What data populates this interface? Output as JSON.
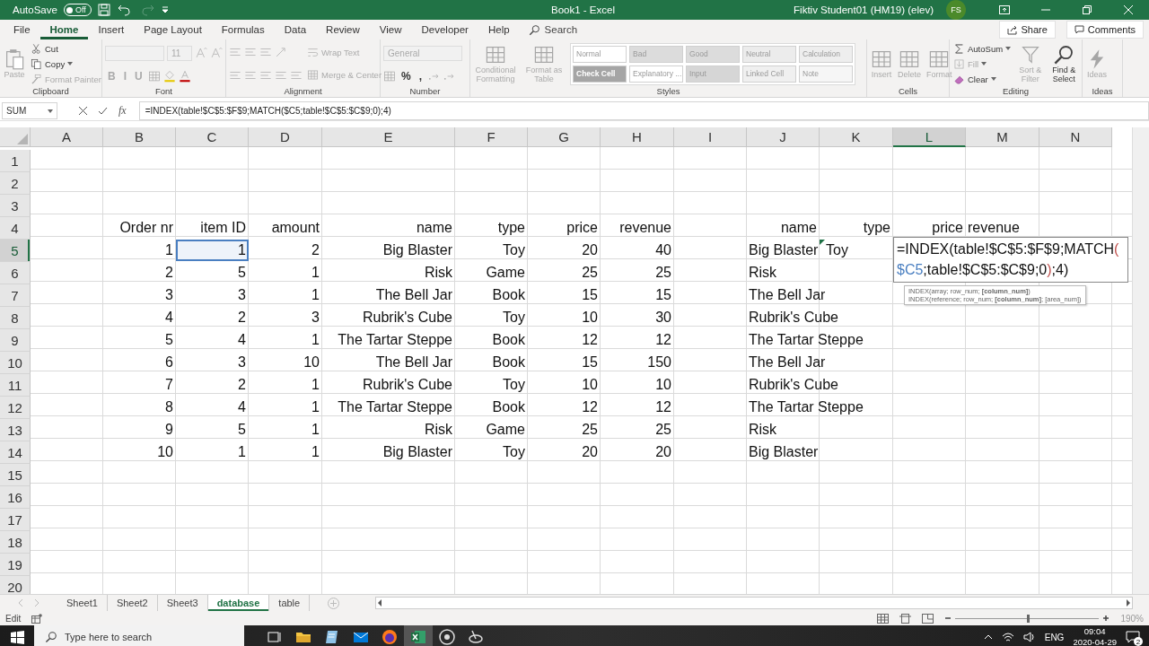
{
  "title_bar": {
    "autosave_label": "AutoSave",
    "autosave_state": "Off",
    "autosave_on": false,
    "title": "Book1  -  Excel",
    "user": "Fiktiv Student01 (HM19) (elev)",
    "avatar": "FS"
  },
  "ribbon_tabs": [
    {
      "label": "File",
      "selected": false
    },
    {
      "label": "Home",
      "selected": true
    },
    {
      "label": "Insert",
      "selected": false
    },
    {
      "label": "Page Layout",
      "selected": false
    },
    {
      "label": "Formulas",
      "selected": false
    },
    {
      "label": "Data",
      "selected": false
    },
    {
      "label": "Review",
      "selected": false
    },
    {
      "label": "View",
      "selected": false
    },
    {
      "label": "Developer",
      "selected": false
    },
    {
      "label": "Help",
      "selected": false
    }
  ],
  "search": "Search",
  "share": "Share",
  "comments": "Comments",
  "ribbon_groups": [
    {
      "label": "Clipboard",
      "columns": [
        [
          [
            {
              "kind": "large",
              "label": "Paste",
              "disabled": true
            }
          ]
        ],
        [
          [
            {
              "kind": "small",
              "label": "Cut",
              "disabled": false
            }
          ],
          [
            {
              "kind": "small",
              "label": "Copy",
              "disabled": false,
              "caret": true
            }
          ],
          [
            {
              "kind": "small",
              "label": "Format Painter",
              "disabled": true
            }
          ]
        ]
      ]
    },
    {
      "label": "Font",
      "columns": [
        [
          [
            {
              "kind": "field",
              "disabled": true
            },
            {
              "kind": "field",
              "text": "11",
              "disabled": true
            },
            {
              "kind": "icon"
            },
            {
              "kind": "icon"
            }
          ],
          [
            {
              "kind": "glyph",
              "text": "B",
              "disabled": true
            },
            {
              "kind": "glyph",
              "text": "I",
              "disabled": true
            },
            {
              "kind": "glyph",
              "text": "U",
              "disabled": true
            },
            {
              "kind": "icon"
            },
            {
              "kind": "icon"
            },
            {
              "kind": "icon"
            }
          ]
        ]
      ]
    },
    {
      "label": "Alignment",
      "columns": [
        [
          [
            {
              "kind": "icon"
            },
            {
              "kind": "icon"
            },
            {
              "kind": "icon"
            },
            {
              "kind": "icon"
            }
          ],
          [
            {
              "kind": "icon"
            },
            {
              "kind": "icon"
            },
            {
              "kind": "icon"
            },
            {
              "kind": "icon"
            },
            {
              "kind": "icon"
            }
          ]
        ],
        [
          [
            {
              "kind": "small",
              "label": "Wrap Text",
              "disabled": true
            }
          ],
          [
            {
              "kind": "small",
              "label": "Merge & Center",
              "disabled": true
            }
          ]
        ]
      ]
    },
    {
      "label": "Number",
      "columns": [
        [
          [
            {
              "kind": "field",
              "text": "General",
              "disabled": true
            }
          ],
          [
            {
              "kind": "icon"
            },
            {
              "kind": "glyph",
              "text": "%",
              "disabled": false
            },
            {
              "kind": "glyph",
              "text": ",",
              "disabled": false
            },
            {
              "kind": "icon"
            },
            {
              "kind": "icon"
            }
          ]
        ]
      ]
    },
    {
      "label": "Styles",
      "columns": [
        [
          [
            {
              "kind": "large",
              "label": "Conditional Formatting",
              "disabled": true
            }
          ]
        ],
        [
          [
            {
              "kind": "large",
              "label": "Format as Table",
              "disabled": true
            }
          ]
        ],
        [
          [
            {
              "kind": "style",
              "label": "Normal",
              "color": "#ffffff"
            },
            {
              "kind": "style",
              "label": "Bad",
              "color": "#dcdcdc"
            },
            {
              "kind": "style",
              "label": "Good",
              "color": "#dcdcdc"
            },
            {
              "kind": "style",
              "label": "Neutral",
              "color": "#ececec"
            },
            {
              "kind": "style",
              "label": "Calculation",
              "color": "#eeeeee"
            }
          ],
          [
            {
              "kind": "style",
              "label": "Check Cell",
              "color": "#a5a5a5"
            },
            {
              "kind": "style",
              "label": "Explanatory ...",
              "color": "#ffffff"
            },
            {
              "kind": "style",
              "label": "Input",
              "color": "#d6d6d6"
            },
            {
              "kind": "style",
              "label": "Linked Cell",
              "color": "#f0f0f0"
            },
            {
              "kind": "style",
              "label": "Note",
              "color": "#f6f6f6"
            }
          ]
        ]
      ]
    },
    {
      "label": "Cells",
      "columns": [
        [
          [
            {
              "kind": "large",
              "label": "Insert",
              "disabled": true
            }
          ]
        ],
        [
          [
            {
              "kind": "large",
              "label": "Delete",
              "disabled": true
            }
          ]
        ],
        [
          [
            {
              "kind": "large",
              "label": "Format",
              "disabled": true
            }
          ]
        ]
      ]
    },
    {
      "label": "Editing",
      "columns": [
        [
          [
            {
              "kind": "small",
              "label": "AutoSum",
              "disabled": false,
              "caret": true
            }
          ],
          [
            {
              "kind": "small",
              "label": "Fill",
              "disabled": true,
              "caret": true
            }
          ],
          [
            {
              "kind": "small",
              "label": "Clear",
              "disabled": false,
              "caret": true
            }
          ]
        ],
        [
          [
            {
              "kind": "large",
              "label": "Sort & Filter",
              "disabled": true
            }
          ]
        ],
        [
          [
            {
              "kind": "large",
              "label": "Find & Select",
              "disabled": false
            }
          ]
        ]
      ]
    },
    {
      "label": "Ideas",
      "columns": [
        [
          [
            {
              "kind": "large",
              "label": "Ideas",
              "disabled": true
            }
          ]
        ]
      ]
    }
  ],
  "name_box": "SUM",
  "function_button": "fx",
  "formula": "=INDEX(table!$C$5:$F$9;MATCH($C5;table!$C$5:$C$9;0);4)",
  "columns": [
    {
      "label": "A",
      "selected": false
    },
    {
      "label": "B",
      "selected": false
    },
    {
      "label": "C",
      "selected": false
    },
    {
      "label": "D",
      "selected": false
    },
    {
      "label": "E",
      "selected": false
    },
    {
      "label": "F",
      "selected": false
    },
    {
      "label": "G",
      "selected": false
    },
    {
      "label": "H",
      "selected": false
    },
    {
      "label": "I",
      "selected": false
    },
    {
      "label": "J",
      "selected": false
    },
    {
      "label": "K",
      "selected": false
    },
    {
      "label": "L",
      "selected": true
    },
    {
      "label": "M",
      "selected": false
    },
    {
      "label": "N",
      "selected": false
    }
  ],
  "rows": [
    {
      "number": "1",
      "selected": false
    },
    {
      "number": "2",
      "selected": false
    },
    {
      "number": "3",
      "selected": false
    },
    {
      "number": "4",
      "selected": false,
      "cells": [
        null,
        {
          "text": "Order nr"
        },
        {
          "text": "item ID"
        },
        {
          "text": "amount"
        },
        {
          "text": "name"
        },
        {
          "text": "type"
        },
        {
          "text": "price"
        },
        {
          "text": "revenue"
        },
        null,
        {
          "text": "name"
        },
        {
          "text": "type"
        },
        {
          "text": "price"
        },
        {
          "text": "revenue",
          "left_aligned": true
        }
      ]
    },
    {
      "number": "5",
      "selected": true,
      "cells": [
        null,
        {
          "text": "1"
        },
        {
          "text": "1",
          "referenced": true
        },
        {
          "text": "2"
        },
        {
          "text": "Big Blaster"
        },
        {
          "text": "Toy"
        },
        {
          "text": "20"
        },
        {
          "text": "40"
        },
        null,
        {
          "text": "Big Blaster",
          "left_aligned": true
        },
        {
          "text": "Toy",
          "left_aligned": true,
          "error_flag": true
        }
      ]
    },
    {
      "number": "6",
      "selected": false,
      "cells": [
        null,
        {
          "text": "2"
        },
        {
          "text": "5"
        },
        {
          "text": "1"
        },
        {
          "text": "Risk"
        },
        {
          "text": "Game"
        },
        {
          "text": "25"
        },
        {
          "text": "25"
        },
        null,
        {
          "text": "Risk",
          "left_aligned": true
        }
      ]
    },
    {
      "number": "7",
      "selected": false,
      "cells": [
        null,
        {
          "text": "3"
        },
        {
          "text": "3"
        },
        {
          "text": "1"
        },
        {
          "text": "The Bell Jar"
        },
        {
          "text": "Book"
        },
        {
          "text": "15"
        },
        {
          "text": "15"
        },
        null,
        {
          "text": "The Bell Jar",
          "left_aligned": true
        }
      ]
    },
    {
      "number": "8",
      "selected": false,
      "cells": [
        null,
        {
          "text": "4"
        },
        {
          "text": "2"
        },
        {
          "text": "3"
        },
        {
          "text": "Rubrik's Cube"
        },
        {
          "text": "Toy"
        },
        {
          "text": "10"
        },
        {
          "text": "30"
        },
        null,
        {
          "text": "Rubrik's Cube",
          "left_aligned": true
        }
      ]
    },
    {
      "number": "9",
      "selected": false,
      "cells": [
        null,
        {
          "text": "5"
        },
        {
          "text": "4"
        },
        {
          "text": "1"
        },
        {
          "text": "The Tartar Steppe"
        },
        {
          "text": "Book"
        },
        {
          "text": "12"
        },
        {
          "text": "12"
        },
        null,
        {
          "text": "The Tartar Steppe",
          "left_aligned": true
        }
      ]
    },
    {
      "number": "10",
      "selected": false,
      "cells": [
        null,
        {
          "text": "6"
        },
        {
          "text": "3"
        },
        {
          "text": "10"
        },
        {
          "text": "The Bell Jar"
        },
        {
          "text": "Book"
        },
        {
          "text": "15"
        },
        {
          "text": "150"
        },
        null,
        {
          "text": "The Bell Jar",
          "left_aligned": true
        }
      ]
    },
    {
      "number": "11",
      "selected": false,
      "cells": [
        null,
        {
          "text": "7"
        },
        {
          "text": "2"
        },
        {
          "text": "1"
        },
        {
          "text": "Rubrik's Cube"
        },
        {
          "text": "Toy"
        },
        {
          "text": "10"
        },
        {
          "text": "10"
        },
        null,
        {
          "text": "Rubrik's Cube",
          "left_aligned": true
        }
      ]
    },
    {
      "number": "12",
      "selected": false,
      "cells": [
        null,
        {
          "text": "8"
        },
        {
          "text": "4"
        },
        {
          "text": "1"
        },
        {
          "text": "The Tartar Steppe"
        },
        {
          "text": "Book"
        },
        {
          "text": "12"
        },
        {
          "text": "12"
        },
        null,
        {
          "text": "The Tartar Steppe",
          "left_aligned": true
        }
      ]
    },
    {
      "number": "13",
      "selected": false,
      "cells": [
        null,
        {
          "text": "9"
        },
        {
          "text": "5"
        },
        {
          "text": "1"
        },
        {
          "text": "Risk"
        },
        {
          "text": "Game"
        },
        {
          "text": "25"
        },
        {
          "text": "25"
        },
        null,
        {
          "text": "Risk",
          "left_aligned": true
        }
      ]
    },
    {
      "number": "14",
      "selected": false,
      "cells": [
        null,
        {
          "text": "10"
        },
        {
          "text": "1"
        },
        {
          "text": "1"
        },
        {
          "text": "Big Blaster"
        },
        {
          "text": "Toy"
        },
        {
          "text": "20"
        },
        {
          "text": "20"
        },
        null,
        {
          "text": "Big Blaster",
          "left_aligned": true
        }
      ]
    },
    {
      "number": "15",
      "selected": false
    },
    {
      "number": "16",
      "selected": false
    },
    {
      "number": "17",
      "selected": false
    },
    {
      "number": "18",
      "selected": false
    },
    {
      "number": "19",
      "selected": false
    },
    {
      "number": "20",
      "selected": false
    }
  ],
  "cell_editor": {
    "lines": [
      [
        {
          "text": "=INDEX(table!$C$5:$F$9;MATCH"
        },
        {
          "text": "(",
          "color": "#c0504d"
        }
      ],
      [
        {
          "text": "$C5",
          "color": "#4a7fc1"
        },
        {
          "text": ";table!$C$5:$C$9;0"
        },
        {
          "text": ")",
          "color": "#c0504d"
        },
        {
          "text": ";4)"
        }
      ]
    ]
  },
  "tooltip": [
    "INDEX(array; row_num; **[column_num]**)",
    "INDEX(reference; row_num; **[column_num]**; [area_num])"
  ],
  "sheet_tabs": [
    {
      "label": "Sheet1",
      "selected": false
    },
    {
      "label": "Sheet2",
      "selected": false
    },
    {
      "label": "Sheet3",
      "selected": false
    },
    {
      "label": "database",
      "selected": true
    },
    {
      "label": "table",
      "selected": false
    }
  ],
  "status_bar": {
    "mode": "Edit",
    "zoom": {
      "level": 0.5,
      "reading": "190%"
    }
  },
  "taskbar": {
    "search_placeholder": "Type here to search",
    "apps": [
      {
        "selected": false
      },
      {
        "selected": false
      },
      {
        "selected": false
      },
      {
        "selected": false
      },
      {
        "selected": false
      },
      {
        "selected": true
      },
      {
        "selected": false
      },
      {
        "selected": false
      }
    ],
    "language": "ENG",
    "time": "09:04",
    "date": "2020-04-29",
    "notifications": "2"
  }
}
